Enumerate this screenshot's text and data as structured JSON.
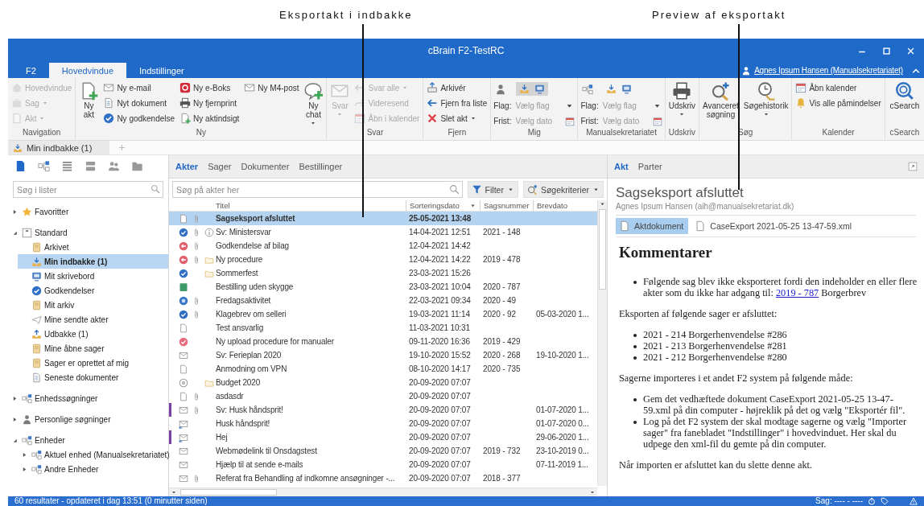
{
  "annotations": [
    {
      "label": "Eksportakt i indbakke"
    },
    {
      "label": "Preview af eksportakt"
    }
  ],
  "window": {
    "title": "cBrain F2-TestRC"
  },
  "menu_tabs": [
    {
      "label": "F2",
      "selected": false
    },
    {
      "label": "Hovedvindue",
      "selected": true
    },
    {
      "label": "Indstillinger",
      "selected": false
    }
  ],
  "user": "Agnes Ipsum Hansen (Manualsekretariatet)",
  "ribbon": {
    "groups": [
      {
        "label": "Navigation",
        "items": [
          {
            "kind": "column",
            "entries": [
              {
                "label": "Hovedvindue",
                "disabled": true,
                "dropdown": false
              },
              {
                "label": "Sag",
                "disabled": true,
                "dropdown": true
              },
              {
                "label": "Akt",
                "disabled": true,
                "dropdown": true
              }
            ]
          }
        ]
      },
      {
        "label": "Ny",
        "items": [
          {
            "kind": "large",
            "label": "Ny akt",
            "disabled": false,
            "dropdown": false
          },
          {
            "kind": "column",
            "entries": [
              {
                "label": "Ny e-mail",
                "disabled": false,
                "dropdown": false
              },
              {
                "label": "Nyt dokument",
                "disabled": false,
                "dropdown": false
              },
              {
                "label": "Ny godkendelse",
                "disabled": false,
                "dropdown": false
              }
            ]
          },
          {
            "kind": "column",
            "entries": [
              {
                "label": "Ny e-Boks",
                "disabled": false,
                "dropdown": false
              },
              {
                "label": "Ny fjernprint",
                "disabled": false,
                "dropdown": false
              },
              {
                "label": "Ny aktindsigt",
                "disabled": false,
                "dropdown": false
              }
            ]
          },
          {
            "kind": "column",
            "entries": [
              {
                "label": "Ny M4-post",
                "disabled": false,
                "dropdown": false
              }
            ]
          },
          {
            "kind": "large",
            "label": "Ny chat",
            "disabled": false,
            "dropdown": true
          }
        ]
      },
      {
        "label": "Svar",
        "items": [
          {
            "kind": "large",
            "label": "Svar",
            "disabled": true,
            "dropdown": true
          },
          {
            "kind": "column",
            "entries": [
              {
                "label": "Svar alle",
                "disabled": true,
                "dropdown": true
              },
              {
                "label": "Videresend",
                "disabled": true,
                "dropdown": false
              },
              {
                "label": "Åbn i kalender",
                "disabled": true,
                "dropdown": false
              }
            ]
          }
        ]
      },
      {
        "label": "Fjern",
        "items": [
          {
            "kind": "column",
            "entries": [
              {
                "label": "Arkivér",
                "disabled": false,
                "dropdown": false
              },
              {
                "label": "Fjern fra liste",
                "disabled": false,
                "dropdown": false
              },
              {
                "label": "Slet akt",
                "disabled": false,
                "dropdown": true
              }
            ]
          }
        ]
      },
      {
        "label": "Mig",
        "items": [
          {
            "kind": "flags",
            "active": true,
            "rows": [
              {
                "kind": "select",
                "label": "Flag:",
                "placeholder": "Vælg flag"
              },
              {
                "kind": "date",
                "label": "Frist:",
                "placeholder": "Vælg dato"
              }
            ]
          }
        ]
      },
      {
        "label": "Manualsekretariatet",
        "items": [
          {
            "kind": "flags",
            "active": false,
            "rows": [
              {
                "kind": "select",
                "label": "Flag:",
                "placeholder": "Vælg flag"
              },
              {
                "kind": "date",
                "label": "Frist:",
                "placeholder": "Vælg dato"
              }
            ]
          }
        ]
      },
      {
        "label": "Udskriv",
        "items": [
          {
            "kind": "large",
            "label": "Udskriv",
            "disabled": false,
            "dropdown": true
          }
        ]
      },
      {
        "label": "Søg",
        "items": [
          {
            "kind": "large",
            "label": "Avanceret søgning",
            "disabled": false,
            "dropdown": false
          },
          {
            "kind": "large",
            "label": "Søgehistorik",
            "disabled": false,
            "dropdown": true
          }
        ]
      },
      {
        "label": "Kalender",
        "items": [
          {
            "kind": "column",
            "entries": [
              {
                "label": "Åbn kalender",
                "disabled": false,
                "dropdown": false
              },
              {
                "label": "Vis alle påmindelser",
                "disabled": false,
                "dropdown": false
              }
            ]
          }
        ]
      },
      {
        "label": "cSearch",
        "items": [
          {
            "kind": "large",
            "label": "cSearch",
            "disabled": false,
            "dropdown": false
          }
        ]
      }
    ]
  },
  "document_tabs": [
    {
      "label": "Min indbakke (1)",
      "selected": true
    }
  ],
  "sidebar": {
    "search": {
      "placeholder": "Søg i lister"
    },
    "tree": [
      {
        "label": "Favoritter",
        "expanded": false,
        "selected": false
      },
      {
        "label": "Standard",
        "expanded": true,
        "selected": false,
        "children": [
          {
            "label": "Arkivet",
            "selected": false
          },
          {
            "label": "Min indbakke (1)",
            "selected": true
          },
          {
            "label": "Mit skrivebord",
            "selected": false
          },
          {
            "label": "Godkendelser",
            "selected": false
          },
          {
            "label": "Mit arkiv",
            "selected": false
          },
          {
            "label": "Mine sendte akter",
            "selected": false
          },
          {
            "label": "Udbakke (1)",
            "selected": false
          },
          {
            "label": "Mine åbne sager",
            "selected": false
          },
          {
            "label": "Sager er oprettet af mig",
            "selected": false
          },
          {
            "label": "Seneste dokumenter",
            "selected": false
          }
        ]
      },
      {
        "label": "Enhedssøgninger",
        "expanded": false,
        "selected": false
      },
      {
        "label": "Personlige søgninger",
        "expanded": false,
        "selected": false
      },
      {
        "label": "Enheder",
        "expanded": true,
        "selected": false,
        "children": [
          {
            "label": "Aktuel enhed (Manualsekretariatet)",
            "expanded": false,
            "selected": false
          },
          {
            "label": "Andre Enheder",
            "expanded": false,
            "selected": false
          }
        ]
      }
    ]
  },
  "list_panel": {
    "tabs": [
      {
        "label": "Akter",
        "selected": true
      },
      {
        "label": "Sager",
        "selected": false
      },
      {
        "label": "Dokumenter",
        "selected": false
      },
      {
        "label": "Bestillinger",
        "selected": false
      }
    ],
    "search": {
      "placeholder": "Søg på akter her"
    },
    "buttons": [
      {
        "label": "Filter"
      },
      {
        "label": "Søgekriterier"
      }
    ],
    "table": {
      "columns": [
        {
          "label": "Titel",
          "sorted": false
        },
        {
          "label": "Sorteringsdato",
          "sorted": true
        },
        {
          "label": "Sagsnummer",
          "sorted": false
        },
        {
          "label": "Brevdato",
          "sorted": false
        }
      ],
      "rows": [
        {
          "kind": "document",
          "attachment": true,
          "has_note": false,
          "in_folder": false,
          "flagged": false,
          "unread": true,
          "selected": true,
          "title": "Sagseksport afsluttet",
          "date": "25-05-2021 13:48"
        },
        {
          "kind": "approved",
          "attachment": true,
          "has_note": true,
          "in_folder": false,
          "flagged": false,
          "unread": false,
          "selected": false,
          "title": "Sv: Ministersvar",
          "date": "14-04-2021 12:51",
          "case": "2021 - 148"
        },
        {
          "kind": "rejected",
          "attachment": true,
          "has_note": false,
          "in_folder": false,
          "flagged": false,
          "unread": false,
          "selected": false,
          "title": "Godkendelse af bilag",
          "date": "12-04-2021 14:42"
        },
        {
          "kind": "rejected",
          "attachment": true,
          "has_note": false,
          "in_folder": true,
          "flagged": false,
          "unread": false,
          "selected": false,
          "title": "Ny procedure",
          "date": "12-04-2021 14:22",
          "case": "2019 - 478"
        },
        {
          "kind": "approved",
          "attachment": false,
          "has_note": false,
          "in_folder": true,
          "flagged": false,
          "unread": false,
          "selected": false,
          "title": "Sommerfest",
          "date": "23-03-2021 15:26"
        },
        {
          "kind": "order",
          "attachment": false,
          "has_note": false,
          "in_folder": false,
          "flagged": false,
          "unread": false,
          "selected": false,
          "title": "Bestilling uden skygge",
          "date": "23-03-2021 10:04",
          "case": "2020 - 787"
        },
        {
          "kind": "pending",
          "attachment": true,
          "has_note": false,
          "in_folder": false,
          "flagged": false,
          "unread": false,
          "selected": false,
          "title": "Fredagsaktivitet",
          "date": "22-03-2021 09:34",
          "case": "2020 - 49"
        },
        {
          "kind": "approved",
          "attachment": true,
          "has_note": false,
          "in_folder": false,
          "flagged": false,
          "unread": false,
          "selected": false,
          "title": "Klagebrev om selleri",
          "date": "19-03-2021 11:14",
          "case": "2020 - 92",
          "letter_date": "05-03-2020 1..."
        },
        {
          "kind": "document",
          "attachment": false,
          "has_note": false,
          "in_folder": false,
          "flagged": false,
          "unread": false,
          "selected": false,
          "title": "Test ansvarlig",
          "date": "11-03-2021 10:31"
        },
        {
          "kind": "completed",
          "attachment": false,
          "has_note": false,
          "in_folder": false,
          "flagged": false,
          "unread": false,
          "selected": false,
          "title": "Ny upload procedure for manualer",
          "date": "09-11-2020 16:36",
          "case": "2019 - 429"
        },
        {
          "kind": "email",
          "attachment": false,
          "has_note": false,
          "in_folder": false,
          "flagged": false,
          "unread": false,
          "selected": false,
          "title": "Sv: Ferieplan 2020",
          "date": "19-10-2020 15:52",
          "case": "2020 - 268",
          "letter_date": "19-10-2020 1..."
        },
        {
          "kind": "document",
          "attachment": false,
          "has_note": false,
          "in_folder": false,
          "flagged": false,
          "unread": false,
          "selected": false,
          "title": "Anmodning om VPN",
          "date": "08-10-2020 14:17",
          "case": "2020 - 735"
        },
        {
          "kind": "cancelled",
          "attachment": false,
          "has_note": false,
          "in_folder": true,
          "flagged": false,
          "unread": false,
          "selected": false,
          "title": "Budget 2020",
          "date": "20-09-2020 07:07"
        },
        {
          "kind": "document",
          "attachment": true,
          "has_note": false,
          "in_folder": false,
          "flagged": false,
          "unread": false,
          "selected": false,
          "title": "asdasdr",
          "date": "20-09-2020 07:07"
        },
        {
          "kind": "email",
          "attachment": true,
          "has_note": false,
          "in_folder": false,
          "flagged": true,
          "unread": false,
          "selected": false,
          "title": "Sv: Husk håndsprit!",
          "date": "20-09-2020 07:07",
          "letter_date": "01-07-2020 1..."
        },
        {
          "kind": "email-incoming",
          "attachment": false,
          "has_note": false,
          "in_folder": false,
          "flagged": false,
          "unread": false,
          "selected": false,
          "title": "Husk håndsprit!",
          "date": "20-09-2020 07:07",
          "letter_date": "01-07-2020 0..."
        },
        {
          "kind": "email-incoming",
          "attachment": false,
          "has_note": false,
          "in_folder": false,
          "flagged": true,
          "unread": false,
          "selected": false,
          "title": "Hej",
          "date": "20-09-2020 07:07",
          "letter_date": "29-06-2020 1..."
        },
        {
          "kind": "email",
          "attachment": false,
          "has_note": false,
          "in_folder": false,
          "flagged": false,
          "unread": false,
          "selected": false,
          "title": "Webmødelink til Onsdagstest",
          "date": "20-09-2020 07:07",
          "case": "2019 - 732",
          "letter_date": "23-10-2019 0..."
        },
        {
          "kind": "email",
          "attachment": false,
          "has_note": false,
          "in_folder": false,
          "flagged": false,
          "unread": false,
          "selected": false,
          "title": "Hjælp til at sende e-mails",
          "date": "20-09-2020 07:07",
          "letter_date": "07-11-2019 1..."
        },
        {
          "kind": "email",
          "attachment": true,
          "has_note": false,
          "in_folder": false,
          "flagged": false,
          "unread": false,
          "selected": false,
          "title": "Referat fra Behandling af indkomne ansøgninger -...",
          "date": "20-09-2020 07:07",
          "case": "2018 - 377"
        }
      ]
    }
  },
  "preview": {
    "tabs": [
      {
        "label": "Akt",
        "selected": true
      },
      {
        "label": "Parter",
        "selected": false
      }
    ],
    "title": "Sagseksport afsluttet",
    "sender": "Agnes Ipsum Hansen (aih@manualsekretariat.dk)",
    "attachments": [
      {
        "label": "Aktdokument",
        "selected": true
      },
      {
        "label": "CaseExport 2021-05-25 13-47-59.xml",
        "selected": false
      }
    ],
    "document": {
      "heading": "Kommentarer",
      "blocks": [
        {
          "kind": "list",
          "items": [
            {
              "text": "Følgende sag blev ikke eksporteret fordi den indeholder en eller flere akter som du ikke har adgang til:",
              "link": "2019 - 787",
              "after": "Borgerbrev"
            }
          ]
        },
        {
          "kind": "paragraph",
          "text": "Eksporten af følgende sager er afsluttet:"
        },
        {
          "kind": "list",
          "items": [
            {
              "text": "2021 - 214 Borgerhenvendelse #286"
            },
            {
              "text": "2021 - 213 Borgerhenvendelse #281"
            },
            {
              "text": "2021 - 212 Borgerhenvendelse #280"
            }
          ]
        },
        {
          "kind": "paragraph",
          "text": "Sagerne importeres i et andet F2 system på følgende måde:"
        },
        {
          "kind": "list",
          "items": [
            {
              "text": "Gem det vedhæftede dokument CaseExport 2021-05-25 13-47-59.xml på din computer - højreklik på det og vælg \"Eksportér fil\"."
            },
            {
              "text": "Log på det F2 system der skal modtage sagerne og vælg \"Importer sager\" fra fanebladet \"Indstillinger\" i hovedvinduet. Her skal du udpege den xml-fil du gemte på din computer."
            }
          ]
        },
        {
          "kind": "paragraph",
          "text": "Når importen er afsluttet kan du slette denne akt."
        }
      ]
    }
  },
  "status_bar": {
    "text": "60 resultater - opdateret i dag 13:51 (0 minutter siden)",
    "case": "Sag: ---- - ----"
  }
}
